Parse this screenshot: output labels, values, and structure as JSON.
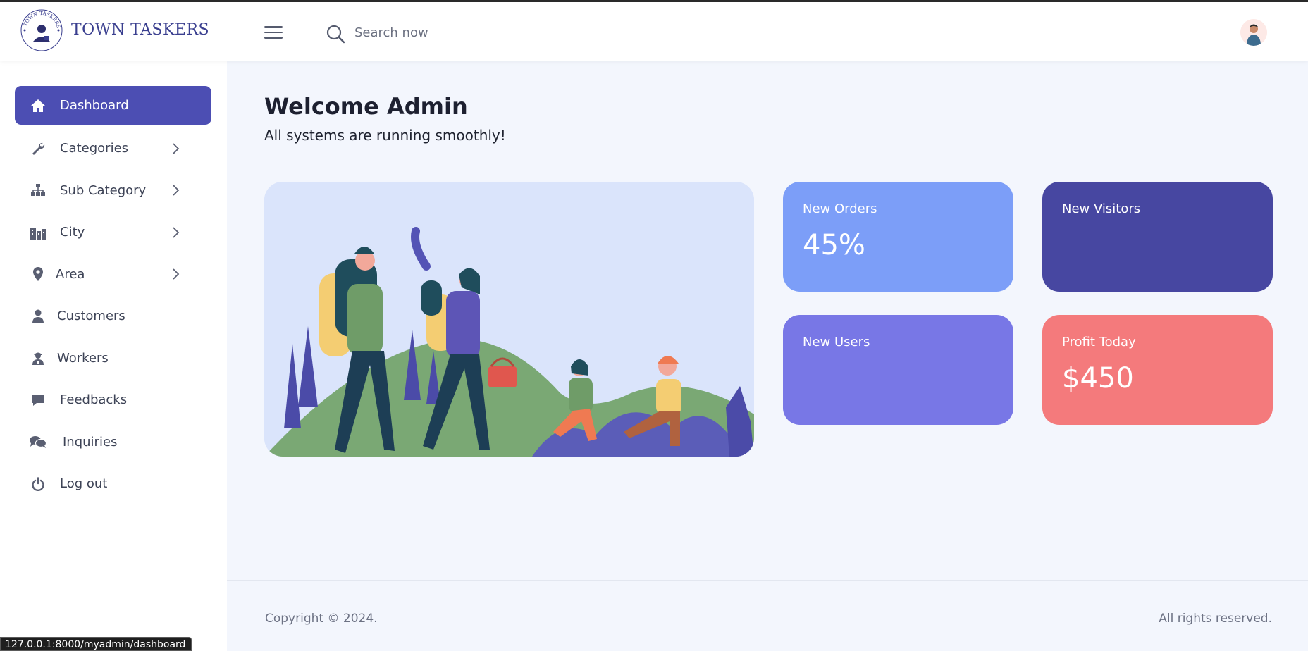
{
  "header": {
    "brand": "TOWN TASKERS",
    "logo_text": "TOWN TASKERS",
    "search_placeholder": "Search now"
  },
  "sidebar": {
    "items": [
      {
        "label": "Dashboard",
        "icon": "home-icon",
        "active": true,
        "has_submenu": false
      },
      {
        "label": "Categories",
        "icon": "wrench-icon",
        "active": false,
        "has_submenu": true
      },
      {
        "label": "Sub Category",
        "icon": "sitemap-icon",
        "active": false,
        "has_submenu": true
      },
      {
        "label": "City",
        "icon": "city-icon",
        "active": false,
        "has_submenu": true
      },
      {
        "label": "Area",
        "icon": "map-pin-icon",
        "active": false,
        "has_submenu": true
      },
      {
        "label": "Customers",
        "icon": "user-icon",
        "active": false,
        "has_submenu": false
      },
      {
        "label": "Workers",
        "icon": "worker-icon",
        "active": false,
        "has_submenu": false
      },
      {
        "label": "Feedbacks",
        "icon": "comment-icon",
        "active": false,
        "has_submenu": false
      },
      {
        "label": "Inquiries",
        "icon": "comments-icon",
        "active": false,
        "has_submenu": false
      },
      {
        "label": "Log out",
        "icon": "power-icon",
        "active": false,
        "has_submenu": false
      }
    ]
  },
  "main": {
    "welcome": "Welcome Admin",
    "subtitle": "All systems are running smoothly!",
    "cards": [
      {
        "label": "New Orders",
        "value": "45%"
      },
      {
        "label": "New Visitors",
        "value": ""
      },
      {
        "label": "New Users",
        "value": ""
      },
      {
        "label": "Profit Today",
        "value": "$450"
      }
    ]
  },
  "footer": {
    "copyright": "Copyright © 2024.",
    "rights": "All rights reserved."
  },
  "status_url": "127.0.0.1:8000/myadmin/dashboard",
  "colors": {
    "accent": "#4c4eb3",
    "card_orders": "#7c9ef8",
    "card_visitors": "#4747a1",
    "card_users": "#7877e6",
    "card_profit": "#f47a7c"
  }
}
